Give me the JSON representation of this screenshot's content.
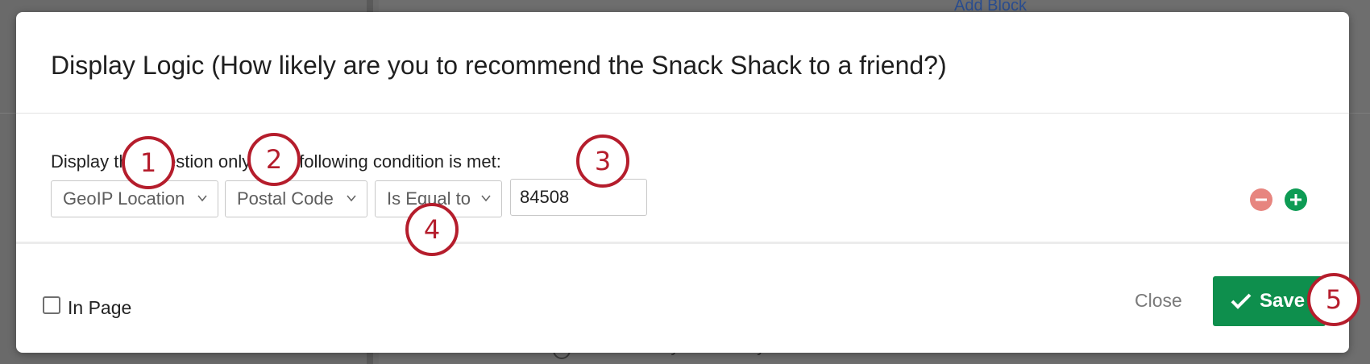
{
  "background": {
    "add_block_link": "Add Block",
    "faint_option_text": "Neither likely nor unlikely"
  },
  "modal": {
    "title": "Display Logic (How likely are you to recommend the Snack Shack to a friend?)",
    "condition_text": "Display this question only if the following condition is met:",
    "condition": {
      "source": "GeoIP Location",
      "field": "Postal Code",
      "operator": "Is Equal to",
      "value": "84508"
    },
    "footer": {
      "in_page_label": "In Page",
      "in_page_checked": false,
      "close_label": "Close",
      "save_label": "Save"
    }
  },
  "callouts": [
    "1",
    "2",
    "3",
    "4",
    "5"
  ],
  "colors": {
    "accent_green": "#0e8f4d",
    "remove_red": "#e7857f",
    "callout_red": "#b51d2c"
  }
}
